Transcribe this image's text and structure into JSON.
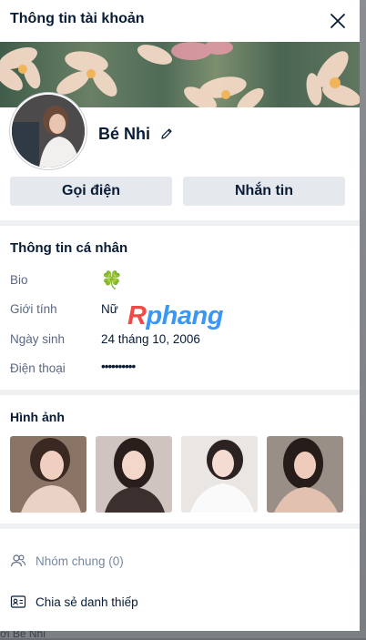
{
  "dialog": {
    "title": "Thông tin tài khoản",
    "close_icon": "close-icon"
  },
  "profile": {
    "name": "Bé Nhi",
    "edit_icon": "pencil-icon"
  },
  "actions": {
    "call_label": "Gọi điện",
    "message_label": "Nhắn tin"
  },
  "personal": {
    "title": "Thông tin cá nhân",
    "rows": [
      {
        "label": "Bio",
        "value": "🍀"
      },
      {
        "label": "Giới tính",
        "value": "Nữ"
      },
      {
        "label": "Ngày sinh",
        "value": "24 tháng 10, 2006"
      },
      {
        "label": "Điện thoại",
        "value": "••••••••••"
      }
    ]
  },
  "watermark": {
    "first": "R",
    "rest": "phang"
  },
  "photos": {
    "title": "Hình ảnh",
    "count": 4
  },
  "footer": {
    "groups_label": "Nhóm chung (0)",
    "share_label": "Chia sẻ danh thiếp"
  },
  "backdrop": {
    "partial_text": "ới Bé Nhi"
  },
  "colors": {
    "primary_text": "#081c36",
    "secondary_text": "#5a6981",
    "button_bg": "#e5e8ec",
    "divider": "#eef0f1"
  }
}
